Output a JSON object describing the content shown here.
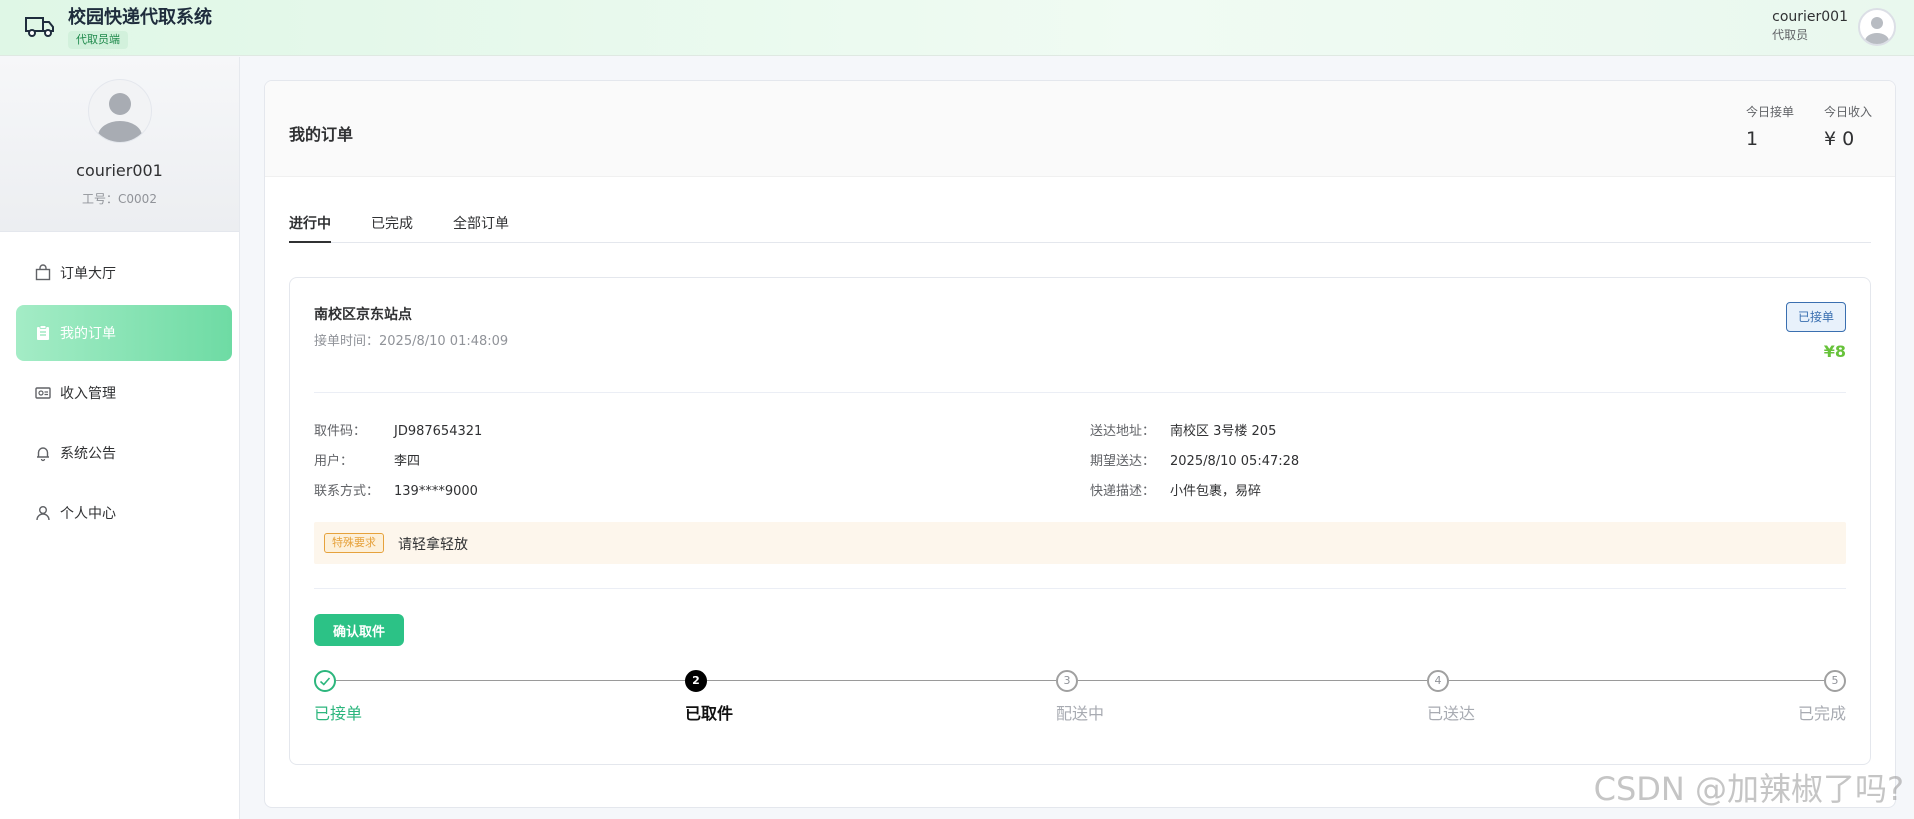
{
  "header": {
    "title": "校园快递代取系统",
    "badge": "代取员端",
    "user_name": "courier001",
    "user_role": "代取员"
  },
  "sidebar": {
    "profile_name": "courier001",
    "profile_id": "工号：C0002",
    "items": [
      {
        "label": "订单大厅",
        "icon": "shopping-bag-icon",
        "active": false
      },
      {
        "label": "我的订单",
        "icon": "clipboard-icon",
        "active": true
      },
      {
        "label": "收入管理",
        "icon": "wallet-icon",
        "active": false
      },
      {
        "label": "系统公告",
        "icon": "bell-icon",
        "active": false
      },
      {
        "label": "个人中心",
        "icon": "user-icon",
        "active": false
      }
    ]
  },
  "main": {
    "title": "我的订单",
    "stats": [
      {
        "label": "今日接单",
        "value": "1"
      },
      {
        "label": "今日收入",
        "value": "¥ 0"
      }
    ],
    "tabs": [
      {
        "label": "进行中",
        "active": true
      },
      {
        "label": "已完成",
        "active": false
      },
      {
        "label": "全部订单",
        "active": false
      }
    ]
  },
  "order": {
    "station": "南校区京东站点",
    "time_label": "接单时间：",
    "time_value": "2025/8/10 01:48:09",
    "status": "已接单",
    "price": "¥8",
    "left_info": [
      {
        "key": "取件码：",
        "value": "JD987654321"
      },
      {
        "key": "用户：",
        "value": "李四"
      },
      {
        "key": "联系方式：",
        "value": "139****9000"
      }
    ],
    "right_info": [
      {
        "key": "送达地址：",
        "value": "南校区 3号楼 205"
      },
      {
        "key": "期望送达：",
        "value": "2025/8/10 05:47:28"
      },
      {
        "key": "快递描述：",
        "value": "小件包裹，易碎"
      }
    ],
    "remark_tag": "特殊要求",
    "remark_text": "请轻拿轻放",
    "confirm_label": "确认取件",
    "steps": [
      {
        "label": "已接单",
        "state": "done",
        "num": "1"
      },
      {
        "label": "已取件",
        "state": "current",
        "num": "2"
      },
      {
        "label": "配送中",
        "state": "pending",
        "num": "3"
      },
      {
        "label": "已送达",
        "state": "pending",
        "num": "4"
      },
      {
        "label": "已完成",
        "state": "pending",
        "num": "5"
      }
    ]
  },
  "watermark": "CSDN @加辣椒了吗?",
  "colors": {
    "accent": "#2cc286",
    "active_menu": "#6edba4",
    "price": "#67c23a",
    "status_tag": "#3a6fb0"
  }
}
